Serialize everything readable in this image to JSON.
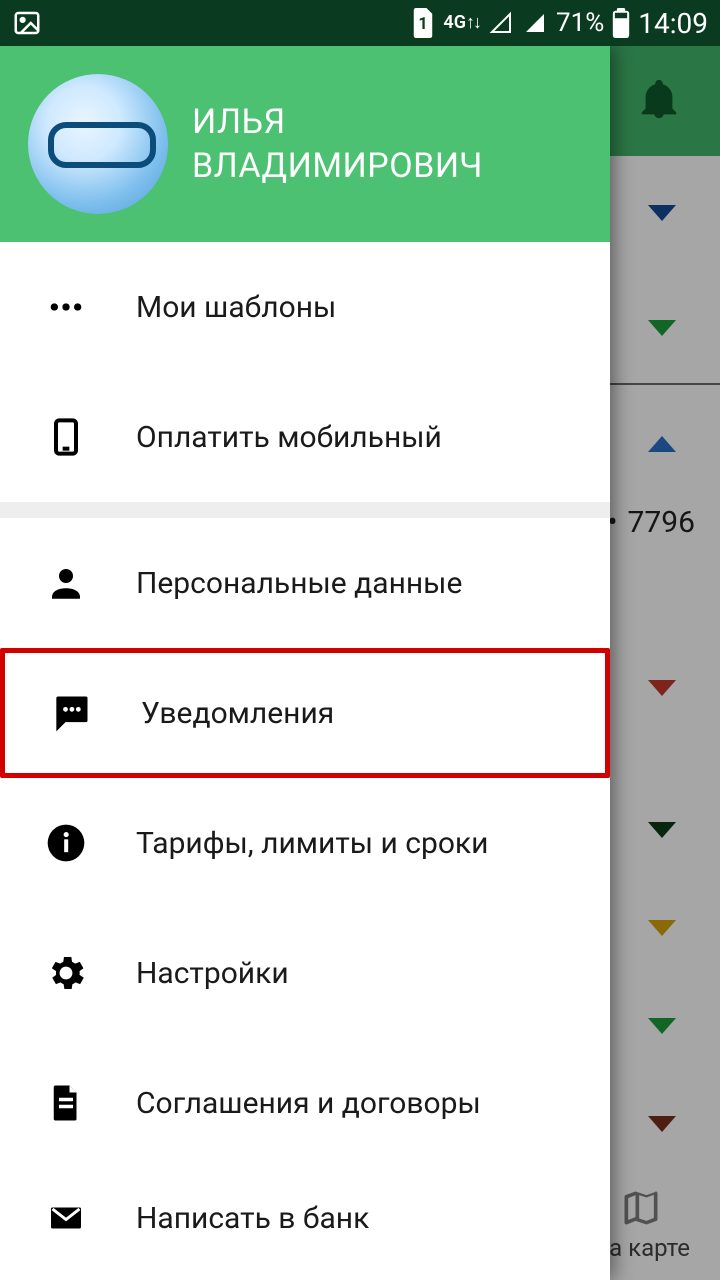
{
  "status": {
    "battery_pct": "71%",
    "time": "14:09",
    "sim_label": "1",
    "net_label": "4G"
  },
  "user": {
    "first": "ИЛЬЯ",
    "last": "ВЛАДИМИРОВИЧ"
  },
  "menu": {
    "templates": "Мои шаблоны",
    "pay_mobile": "Оплатить мобильный",
    "personal": "Персональные данные",
    "notifications": "Уведомления",
    "tariffs": "Тарифы, лимиты и сроки",
    "settings": "Настройки",
    "agreements": "Соглашения и договоры",
    "write_bank": "Написать в банк"
  },
  "main": {
    "card_tail": "7796",
    "map_label": "На карте"
  }
}
